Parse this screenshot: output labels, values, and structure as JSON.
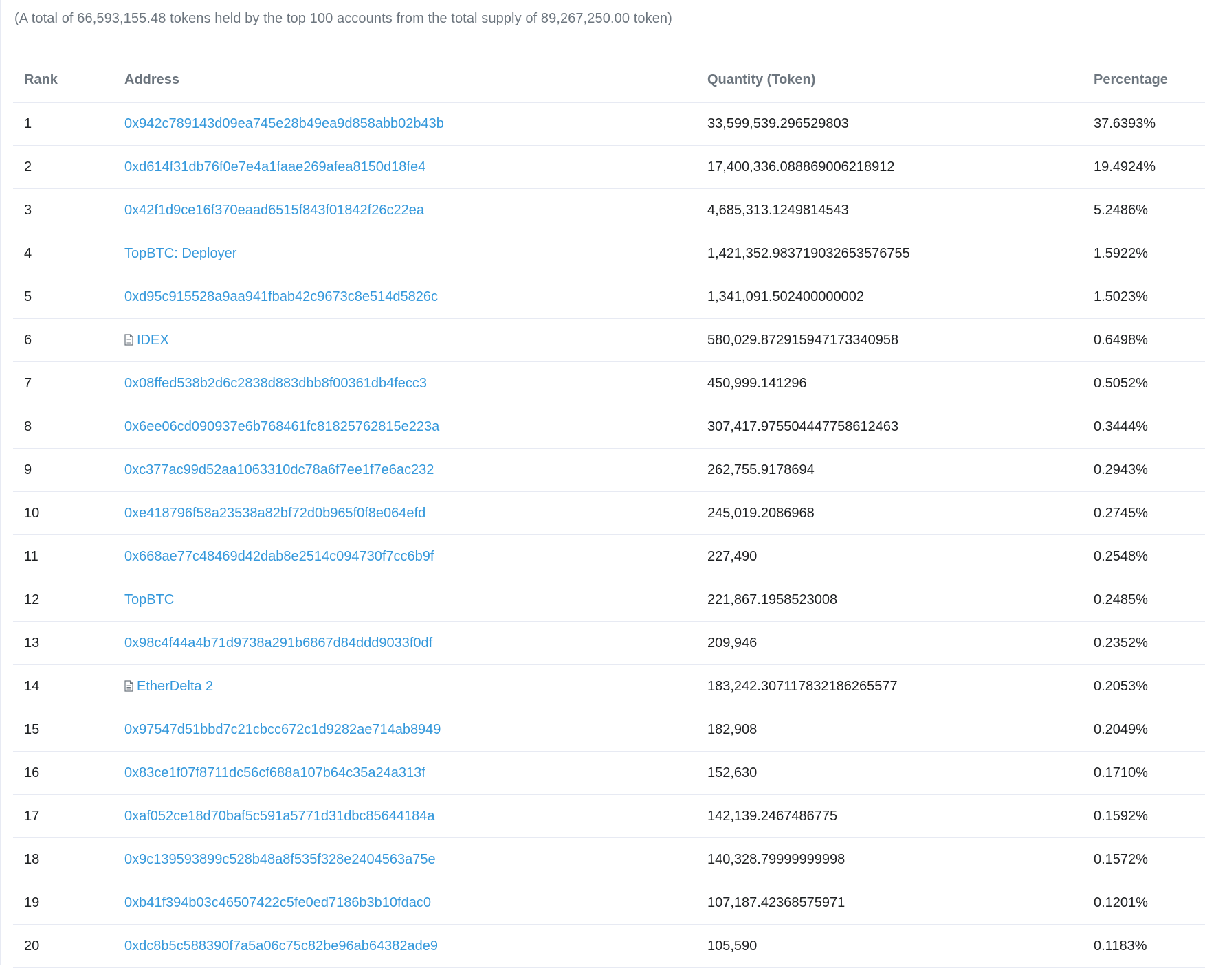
{
  "summary": "(A total of 66,593,155.48 tokens held by the top 100 accounts from the total supply of 89,267,250.00 token)",
  "table": {
    "headers": {
      "rank": "Rank",
      "address": "Address",
      "quantity": "Quantity (Token)",
      "percentage": "Percentage"
    },
    "rows": [
      {
        "rank": "1",
        "address": "0x942c789143d09ea745e28b49ea9d858abb02b43b",
        "contract": false,
        "quantity": "33,599,539.296529803",
        "percentage": "37.6393%"
      },
      {
        "rank": "2",
        "address": "0xd614f31db76f0e7e4a1faae269afea8150d18fe4",
        "contract": false,
        "quantity": "17,400,336.088869006218912",
        "percentage": "19.4924%"
      },
      {
        "rank": "3",
        "address": "0x42f1d9ce16f370eaad6515f843f01842f26c22ea",
        "contract": false,
        "quantity": "4,685,313.1249814543",
        "percentage": "5.2486%"
      },
      {
        "rank": "4",
        "address": "TopBTC: Deployer",
        "contract": false,
        "quantity": "1,421,352.983719032653576755",
        "percentage": "1.5922%"
      },
      {
        "rank": "5",
        "address": "0xd95c915528a9aa941fbab42c9673c8e514d5826c",
        "contract": false,
        "quantity": "1,341,091.502400000002",
        "percentage": "1.5023%"
      },
      {
        "rank": "6",
        "address": "IDEX",
        "contract": true,
        "quantity": "580,029.872915947173340958",
        "percentage": "0.6498%"
      },
      {
        "rank": "7",
        "address": "0x08ffed538b2d6c2838d883dbb8f00361db4fecc3",
        "contract": false,
        "quantity": "450,999.141296",
        "percentage": "0.5052%"
      },
      {
        "rank": "8",
        "address": "0x6ee06cd090937e6b768461fc81825762815e223a",
        "contract": false,
        "quantity": "307,417.975504447758612463",
        "percentage": "0.3444%"
      },
      {
        "rank": "9",
        "address": "0xc377ac99d52aa1063310dc78a6f7ee1f7e6ac232",
        "contract": false,
        "quantity": "262,755.9178694",
        "percentage": "0.2943%"
      },
      {
        "rank": "10",
        "address": "0xe418796f58a23538a82bf72d0b965f0f8e064efd",
        "contract": false,
        "quantity": "245,019.2086968",
        "percentage": "0.2745%"
      },
      {
        "rank": "11",
        "address": "0x668ae77c48469d42dab8e2514c094730f7cc6b9f",
        "contract": false,
        "quantity": "227,490",
        "percentage": "0.2548%"
      },
      {
        "rank": "12",
        "address": "TopBTC",
        "contract": false,
        "quantity": "221,867.1958523008",
        "percentage": "0.2485%"
      },
      {
        "rank": "13",
        "address": "0x98c4f44a4b71d9738a291b6867d84ddd9033f0df",
        "contract": false,
        "quantity": "209,946",
        "percentage": "0.2352%"
      },
      {
        "rank": "14",
        "address": "EtherDelta 2",
        "contract": true,
        "quantity": "183,242.307117832186265577",
        "percentage": "0.2053%"
      },
      {
        "rank": "15",
        "address": "0x97547d51bbd7c21cbcc672c1d9282ae714ab8949",
        "contract": false,
        "quantity": "182,908",
        "percentage": "0.2049%"
      },
      {
        "rank": "16",
        "address": "0x83ce1f07f8711dc56cf688a107b64c35a24a313f",
        "contract": false,
        "quantity": "152,630",
        "percentage": "0.1710%"
      },
      {
        "rank": "17",
        "address": "0xaf052ce18d70baf5c591a5771d31dbc85644184a",
        "contract": false,
        "quantity": "142,139.2467486775",
        "percentage": "0.1592%"
      },
      {
        "rank": "18",
        "address": "0x9c139593899c528b48a8f535f328e2404563a75e",
        "contract": false,
        "quantity": "140,328.79999999998",
        "percentage": "0.1572%"
      },
      {
        "rank": "19",
        "address": "0xb41f394b03c46507422c5fe0ed7186b3b10fdac0",
        "contract": false,
        "quantity": "107,187.42368575971",
        "percentage": "0.1201%"
      },
      {
        "rank": "20",
        "address": "0xdc8b5c588390f7a5a06c75c82be96ab64382ade9",
        "contract": false,
        "quantity": "105,590",
        "percentage": "0.1183%"
      }
    ]
  },
  "icons": {
    "contract": "file-text-icon"
  },
  "colors": {
    "link": "#3498db",
    "header_text": "#6c757e",
    "body_text": "#1e2022",
    "border": "#e7eaf3"
  }
}
